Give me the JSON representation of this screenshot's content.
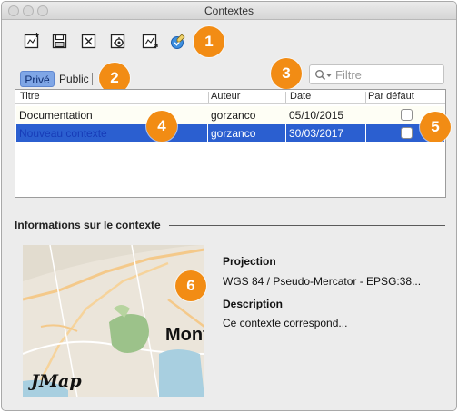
{
  "window": {
    "title": "Contextes"
  },
  "toolbar": {
    "icons": [
      "new-context-icon",
      "save-context-icon",
      "delete-context-icon",
      "settings-context-icon",
      "export-context-icon",
      "apply-context-icon"
    ]
  },
  "callouts": [
    "1",
    "2",
    "3",
    "4",
    "5",
    "6"
  ],
  "tabs": {
    "private": "Privé",
    "public": "Public"
  },
  "filter": {
    "placeholder": "Filtre",
    "value": ""
  },
  "table": {
    "columns": [
      "Titre",
      "Auteur",
      "Date",
      "Par défaut"
    ],
    "rows": [
      {
        "title": "Documentation",
        "author": "gorzanco",
        "date": "05/10/2015",
        "default": false,
        "selected": false
      },
      {
        "title": "Nouveau contexte",
        "author": "gorzanco",
        "date": "30/03/2017",
        "default": false,
        "selected": true
      }
    ]
  },
  "info": {
    "section_title": "Informations sur le contexte",
    "projection_label": "Projection",
    "projection_value": "WGS 84 / Pseudo-Mercator - EPSG:38...",
    "description_label": "Description",
    "description_value": "Ce contexte correspond..."
  },
  "map": {
    "city_label": "Mont",
    "logo": "JMap"
  },
  "colors": {
    "accent": "#f28c14",
    "selection": "#2b5fd0",
    "segment_active": "#7fa6e6"
  }
}
